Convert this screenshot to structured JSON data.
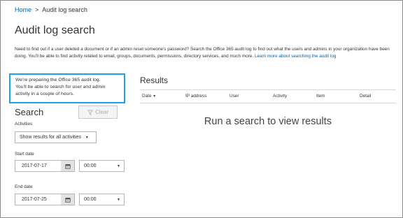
{
  "breadcrumb": {
    "home": "Home",
    "separator": ">",
    "current": "Audit log search"
  },
  "page": {
    "title": "Audit log search",
    "intro_text": "Need to find out if a user deleted a document or if an admin reset someone's password? Search the Office 365 audit log to find out what the users and admins in your organization have been doing. You'll be able to find activity related to email, groups, documents, permissions, directory services, and much more. ",
    "intro_link": "Learn more about searching the audit log"
  },
  "notice": {
    "line1": "We're preparing the Office 365 audit log.",
    "line2": "You'll be able to search for user and admin",
    "line3": "activity in a couple of hours."
  },
  "search": {
    "title": "Search",
    "clear_label": "Clear",
    "activities_label": "Activities",
    "activities_value": "Show results for all activities",
    "start_label": "Start date",
    "start_date": "2017-07-17",
    "start_time": "00:00",
    "end_label": "End date",
    "end_date": "2017-07-25",
    "end_time": "00:00"
  },
  "results": {
    "title": "Results",
    "columns": [
      "Date",
      "IP address",
      "User",
      "Activity",
      "Item",
      "Detail"
    ],
    "empty_message": "Run a search to view results"
  },
  "colors": {
    "accent": "#0062a8",
    "notice_border": "#1aa3e0"
  }
}
